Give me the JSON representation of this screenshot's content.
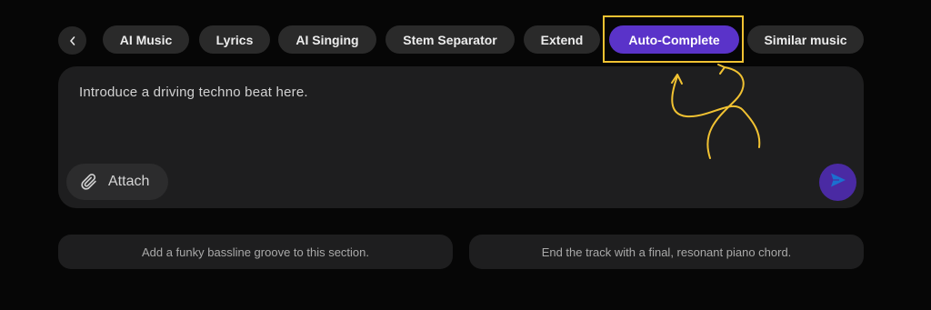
{
  "tabs": [
    {
      "id": "ai-music",
      "label": "AI Music"
    },
    {
      "id": "lyrics",
      "label": "Lyrics"
    },
    {
      "id": "ai-singing",
      "label": "AI Singing"
    },
    {
      "id": "stem-separator",
      "label": "Stem Separator"
    },
    {
      "id": "extend",
      "label": "Extend"
    },
    {
      "id": "auto-complete",
      "label": "Auto-Complete",
      "active": true
    },
    {
      "id": "similar-music",
      "label": "Similar music"
    }
  ],
  "back_icon": "chevron-left-icon",
  "prompt": {
    "text": "Introduce a driving techno beat here.",
    "attach_label": "Attach",
    "attach_icon": "paperclip-icon",
    "send_icon": "send-icon"
  },
  "suggestions": [
    "Add a funky bassline groove to this section.",
    "End the track with a final, resonant piano chord."
  ],
  "colors": {
    "accent": "#5a33c9",
    "highlight": "#f1c232",
    "panel": "#1e1e1f",
    "background": "#060606"
  }
}
